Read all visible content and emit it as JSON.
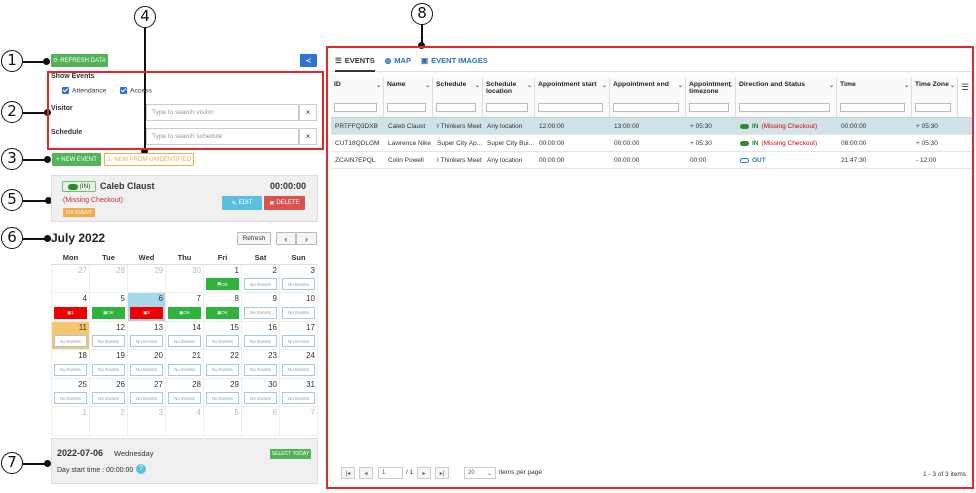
{
  "callouts": [
    "1",
    "2",
    "3",
    "4",
    "5",
    "6",
    "7",
    "8"
  ],
  "toolbar": {
    "refresh_label": "REFRESH DATA"
  },
  "filters": {
    "show_events_label": "Show Events",
    "attendance_label": "Attendance",
    "access_label": "Access",
    "visitor_label": "Visitor",
    "visitor_placeholder": "Type to search visitor",
    "schedule_label": "Schedule",
    "schedule_placeholder": "Type to search schedule",
    "clear_glyph": "×"
  },
  "actions": {
    "new_event_label": "+ NEW EVENT",
    "new_unidentified_label": "NEW FROM UNIDENTIFIED"
  },
  "event_card": {
    "status": "(IN)",
    "name": "Caleb Claust",
    "time": "00:00:00",
    "warning": "(Missing Checkout)",
    "fix_label": "FIX EVENT",
    "edit_label": "EDIT",
    "delete_label": "DELETE"
  },
  "calendar": {
    "month": "July 2022",
    "refresh_label": "Refresh",
    "prev": "‹",
    "next": "›",
    "weekdays": [
      "Mon",
      "Tue",
      "Wed",
      "Thu",
      "Fri",
      "Sat",
      "Sun"
    ],
    "weeks": [
      [
        {
          "d": "27",
          "o": true
        },
        {
          "d": "28",
          "o": true
        },
        {
          "d": "29",
          "o": true
        },
        {
          "d": "30",
          "o": true
        },
        {
          "d": "1",
          "ev": "ok",
          "t": "OK"
        },
        {
          "d": "2",
          "ev": "none",
          "t": "No Events"
        },
        {
          "d": "3",
          "ev": "none",
          "t": "No Events"
        }
      ],
      [
        {
          "d": "4",
          "ev": "err",
          "t": "1"
        },
        {
          "d": "5",
          "ev": "ok",
          "t": "OK"
        },
        {
          "d": "6",
          "ev": "err",
          "t": "2",
          "sel": true
        },
        {
          "d": "7",
          "ev": "ok",
          "t": "OK"
        },
        {
          "d": "8",
          "ev": "ok",
          "t": "OK"
        },
        {
          "d": "9",
          "ev": "none",
          "t": "No Events"
        },
        {
          "d": "10",
          "ev": "none",
          "t": "No Events"
        }
      ],
      [
        {
          "d": "11",
          "ev": "none",
          "t": "No Events",
          "today": true
        },
        {
          "d": "12",
          "ev": "none",
          "t": "No Events"
        },
        {
          "d": "13",
          "ev": "none",
          "t": "No Events"
        },
        {
          "d": "14",
          "ev": "none",
          "t": "No Events"
        },
        {
          "d": "15",
          "ev": "none",
          "t": "No Events"
        },
        {
          "d": "16",
          "ev": "none",
          "t": "No Events"
        },
        {
          "d": "17",
          "ev": "none",
          "t": "No Events"
        }
      ],
      [
        {
          "d": "18",
          "ev": "none",
          "t": "No Events"
        },
        {
          "d": "19",
          "ev": "none",
          "t": "No Events"
        },
        {
          "d": "20",
          "ev": "none",
          "t": "No Events"
        },
        {
          "d": "21",
          "ev": "none",
          "t": "No Events"
        },
        {
          "d": "22",
          "ev": "none",
          "t": "No Events"
        },
        {
          "d": "23",
          "ev": "none",
          "t": "No Events"
        },
        {
          "d": "24",
          "ev": "none",
          "t": "No Events"
        }
      ],
      [
        {
          "d": "25",
          "ev": "none",
          "t": "No Events"
        },
        {
          "d": "26",
          "ev": "none",
          "t": "No Events"
        },
        {
          "d": "27",
          "ev": "none",
          "t": "No Events"
        },
        {
          "d": "28",
          "ev": "none",
          "t": "No Events"
        },
        {
          "d": "29",
          "ev": "none",
          "t": "No Events"
        },
        {
          "d": "30",
          "ev": "none",
          "t": "No Events"
        },
        {
          "d": "31",
          "ev": "none",
          "t": "No Events"
        }
      ],
      [
        {
          "d": "1",
          "o": true
        },
        {
          "d": "2",
          "o": true
        },
        {
          "d": "3",
          "o": true
        },
        {
          "d": "4",
          "o": true
        },
        {
          "d": "5",
          "o": true
        },
        {
          "d": "6",
          "o": true
        },
        {
          "d": "7",
          "o": true
        }
      ]
    ]
  },
  "day_panel": {
    "date": "2022-07-06",
    "weekday": "Wednesday",
    "select_today_label": "SELECT TODAY",
    "start_time": "Day start time : 00:00:00",
    "help_glyph": "?"
  },
  "tabs": [
    {
      "label": "EVENTS"
    },
    {
      "label": "MAP"
    },
    {
      "label": "EVENT IMAGES"
    }
  ],
  "grid": {
    "columns": [
      "ID",
      "Name",
      "Schedule",
      "Schedule location",
      "Appointment start",
      "Appointment end",
      "Appointment timezone",
      "Direction and Status",
      "Time",
      "Time Zone"
    ],
    "rows": [
      {
        "id": "PRTFFQ3DXB",
        "name": "Caleb Claust",
        "schedule": "I Thinkers Meet",
        "location": "Any location",
        "start": "12:00:00",
        "end": "13:00:00",
        "tz": "+ 05:30",
        "dir": "IN",
        "status": "(Missing Checkout)",
        "time": "00:00:00",
        "zone": "+ 05:30"
      },
      {
        "id": "CUT18QDLGM",
        "name": "Lawrence Nike",
        "schedule": "Super City Ap...",
        "location": "Super City Bui...",
        "start": "00:00:00",
        "end": "00:00:00",
        "tz": "+ 05:30",
        "dir": "IN",
        "status": "(Missing Checkout)",
        "time": "08:00:00",
        "zone": "+ 05:30"
      },
      {
        "id": "ZCAIN7EPQL",
        "name": "Colin Powell",
        "schedule": "I Thinkers Meet",
        "location": "Any location",
        "start": "00:00:00",
        "end": "00:00:00",
        "tz": "00:00",
        "dir": "OUT",
        "status": "",
        "time": "21:47:30",
        "zone": "- 12:00"
      }
    ]
  },
  "pager": {
    "first": "|◂",
    "prev": "◂",
    "page": "1",
    "of": "/ 1",
    "next": "▸",
    "last": "▸|",
    "page_size": "20",
    "per_page": "items per page",
    "summary": "1 - 3 of 3 items"
  }
}
